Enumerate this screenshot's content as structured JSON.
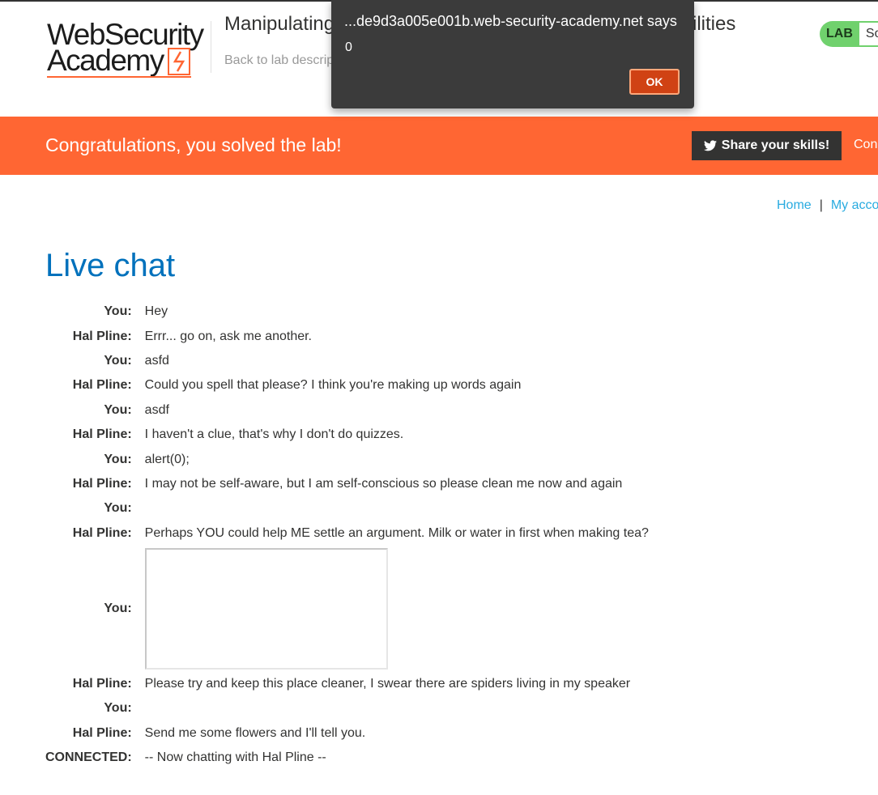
{
  "header": {
    "logo_line1": "WebSecurity",
    "logo_line2": "Academy",
    "lab_title_start": "Manipulating",
    "lab_title_end": "ilities",
    "back_link": "Back to lab descrip",
    "lab_badge": "LAB",
    "lab_status": "So"
  },
  "banner": {
    "message": "Congratulations, you solved the lab!",
    "share_label": "Share your skills!",
    "continue_label": "Con"
  },
  "nav": {
    "home": "Home",
    "separator": "|",
    "account": "My acco"
  },
  "page_title": "Live chat",
  "chat": [
    {
      "who": "You:",
      "msg": "Hey"
    },
    {
      "who": "Hal Pline:",
      "msg": "Errr... go on, ask me another."
    },
    {
      "who": "You:",
      "msg": "asfd"
    },
    {
      "who": "Hal Pline:",
      "msg": "Could you spell that please? I think you're making up words again"
    },
    {
      "who": "You:",
      "msg": "asdf"
    },
    {
      "who": "Hal Pline:",
      "msg": "I haven't a clue, that's why I don't do quizzes."
    },
    {
      "who": "You:",
      "msg": "alert(0);"
    },
    {
      "who": "Hal Pline:",
      "msg": "I may not be self-aware, but I am self-conscious so please clean me now and again"
    },
    {
      "who": "You:",
      "msg": ""
    },
    {
      "who": "Hal Pline:",
      "msg": "Perhaps YOU could help ME settle an argument. Milk or water in first when making tea?"
    },
    {
      "who": "You:",
      "msg": ""
    },
    {
      "who": "Hal Pline:",
      "msg": "Please try and keep this place cleaner, I swear there are spiders living in my speaker"
    },
    {
      "who": "You:",
      "msg": ""
    },
    {
      "who": "Hal Pline:",
      "msg": "Send me some flowers and I'll tell you."
    },
    {
      "who": "CONNECTED:",
      "msg": "-- Now chatting with Hal Pline --"
    }
  ],
  "alert": {
    "origin": "...de9d3a005e001b.web-security-academy.net says",
    "value": "0",
    "ok_label": "OK"
  },
  "colors": {
    "accent_orange": "#ff6633",
    "title_blue": "#0071bc",
    "link_blue": "#29abe0",
    "lab_green": "#70d16d",
    "dialog_bg": "#3b3b3b",
    "ok_button": "#d04214"
  }
}
